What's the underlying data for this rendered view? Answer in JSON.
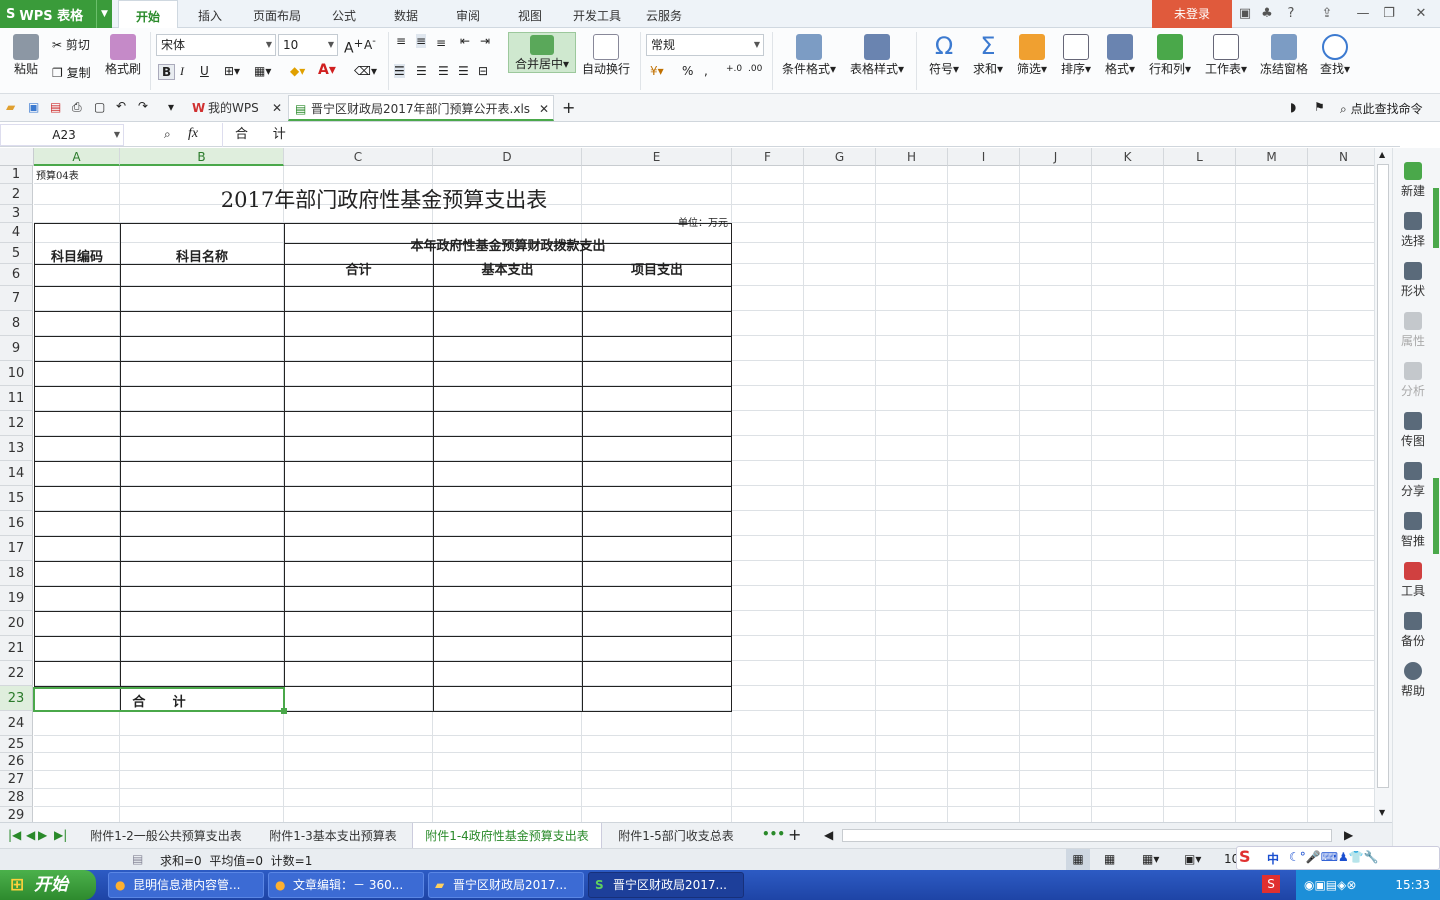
{
  "app": {
    "title": "WPS 表格",
    "login": "未登录"
  },
  "menu_tabs": [
    "开始",
    "插入",
    "页面布局",
    "公式",
    "数据",
    "审阅",
    "视图",
    "开发工具",
    "云服务"
  ],
  "ribbon": {
    "paste": "粘贴",
    "cut": "剪切",
    "copy": "复制",
    "format_painter": "格式刷",
    "font_name": "宋体",
    "font_size": "10",
    "merge_center": "合并居中",
    "wrap_text": "自动换行",
    "number_format": "常规",
    "cond_format": "条件格式",
    "table_style": "表格样式",
    "symbol": "符号",
    "sum": "求和",
    "filter": "筛选",
    "sort": "排序",
    "format": "格式",
    "row_col": "行和列",
    "worksheet": "工作表",
    "freeze": "冻结窗格",
    "find": "查找"
  },
  "doc_tabs": {
    "wps": "我的WPS",
    "file": "晋宁区财政局2017年部门预算公开表.xls",
    "search": "点此查找命令"
  },
  "formula_bar": {
    "cell_ref": "A23",
    "fx": "fx",
    "content": "合      计"
  },
  "columns": [
    "A",
    "B",
    "C",
    "D",
    "E",
    "F",
    "G",
    "H",
    "I",
    "J",
    "K",
    "L",
    "M",
    "N"
  ],
  "rows": [
    "1",
    "2",
    "3",
    "4",
    "5",
    "6",
    "7",
    "8",
    "9",
    "10",
    "11",
    "12",
    "13",
    "14",
    "15",
    "16",
    "17",
    "18",
    "19",
    "20",
    "21",
    "22",
    "23",
    "24",
    "25",
    "26",
    "27",
    "28",
    "29"
  ],
  "sheet": {
    "a1": "预算04表",
    "title": "2017年部门政府性基金预算支出表",
    "unit": "单位：万元",
    "h_code": "科目编码",
    "h_name": "科目名称",
    "h_group": "本年政府性基金预算财政拨款支出",
    "h_total": "合计",
    "h_basic": "基本支出",
    "h_project": "项目支出",
    "total_row": "合      计"
  },
  "right_sidebar": [
    "新建",
    "选择",
    "形状",
    "属性",
    "分析",
    "传图",
    "分享",
    "智推",
    "工具",
    "备份",
    "帮助"
  ],
  "sheet_tabs": [
    "附件1-2一般公共预算支出表",
    "附件1-3基本支出预算表",
    "附件1-4政府性基金预算支出表",
    "附件1-5部门收支总表"
  ],
  "status": {
    "text": "求和=0  平均值=0  计数=1",
    "zoom": "10"
  },
  "taskbar": {
    "start": "开始",
    "items": [
      "昆明信息港内容管...",
      "文章编辑：－ 360...",
      "晋宁区财政局2017...",
      "晋宁区财政局2017..."
    ],
    "ime": "中",
    "clock": "15:33"
  }
}
